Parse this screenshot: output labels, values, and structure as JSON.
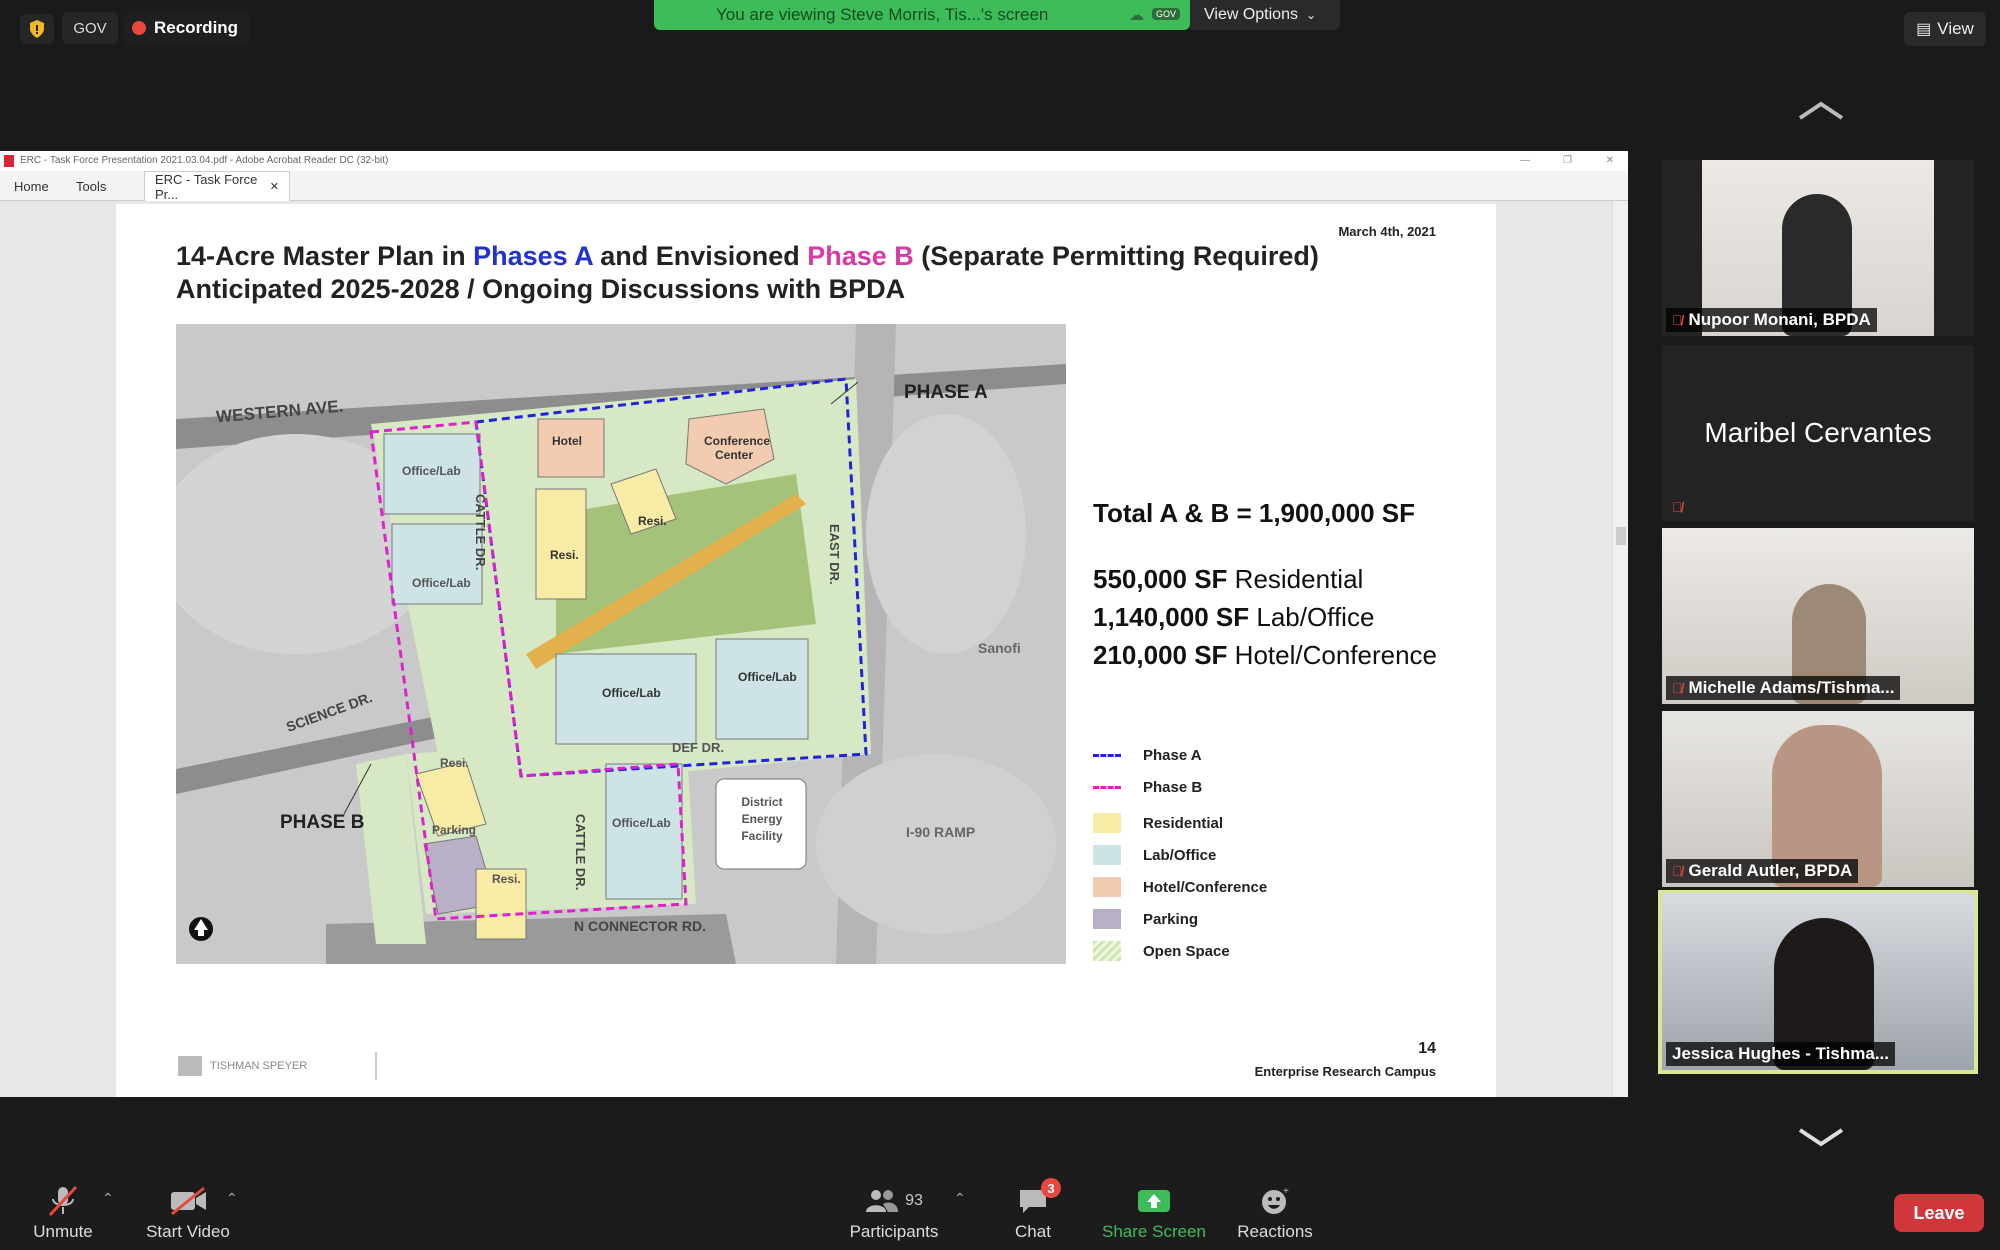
{
  "top": {
    "gov_label": "GOV",
    "recording_label": "Recording",
    "viewing_text": "You are viewing Steve Morris, Tis...'s screen",
    "viewing_badge": "GOV",
    "view_options_label": "View Options",
    "view_button_label": "View"
  },
  "acrobat": {
    "window_title": "ERC - Task Force Presentation 2021.03.04.pdf - Adobe Acrobat Reader DC (32-bit)",
    "tabs": [
      "Home",
      "Tools",
      "ERC - Task Force Pr..."
    ]
  },
  "slide": {
    "title_1": "14-Acre Master Plan in ",
    "title_phase_a": "Phases A",
    "title_2": " and Envisioned ",
    "title_phase_b": "Phase B",
    "title_3": " (Separate Permitting Required)",
    "title_line2": "Anticipated 2025-2028 / Ongoing Discussions with BPDA",
    "date": "March 4th, 2021",
    "total": "Total A & B = 1,900,000 SF",
    "areas": [
      {
        "value": "550,000 SF",
        "label": "Residential"
      },
      {
        "value": "1,140,000 SF",
        "label": "Lab/Office"
      },
      {
        "value": "210,000 SF",
        "label": "Hotel/Conference"
      }
    ],
    "legend": [
      {
        "label": "Phase A",
        "color": "#2222dd",
        "kind": "dash"
      },
      {
        "label": "Phase B",
        "color": "#dd22cc",
        "kind": "dash"
      },
      {
        "label": "Residential",
        "color": "#f7eba5",
        "kind": "fill"
      },
      {
        "label": "Lab/Office",
        "color": "#cde3e6",
        "kind": "fill"
      },
      {
        "label": "Hotel/Conference",
        "color": "#f3cbb0",
        "kind": "fill"
      },
      {
        "label": "Parking",
        "color": "#b9b0c8",
        "kind": "fill"
      },
      {
        "label": "Open Space",
        "color": "#cfe6b0",
        "kind": "hatch"
      }
    ],
    "page_number": "14",
    "campus": "Enterprise Research Campus",
    "company": "TISHMAN SPEYER",
    "map": {
      "streets": [
        "WESTERN AVE.",
        "SCIENCE DR.",
        "CATTLE DR.",
        "EAST DR.",
        "DEF DR.",
        "CATTLE DR.",
        "N CONNECTOR RD.",
        "I-90 RAMP"
      ],
      "blocks": [
        "Hotel",
        "Conference Center",
        "Office/Lab",
        "Office/Lab",
        "Resi.",
        "Resi.",
        "Office/Lab",
        "Office/Lab",
        "Resi.",
        "Parking",
        "Resi.",
        "Office/Lab",
        "District Energy Facility"
      ],
      "phase_a_label": "PHASE A",
      "phase_b_label": "PHASE B",
      "sanofi": "Sanofi"
    }
  },
  "participants": [
    {
      "name": "Nupoor Monani, BPDA",
      "muted": true
    },
    {
      "name": "Maribel Cervantes",
      "muted": true
    },
    {
      "name": "Michelle Adams/Tishma...",
      "muted": true
    },
    {
      "name": "Gerald Autler, BPDA",
      "muted": true
    },
    {
      "name": "Jessica Hughes - Tishma...",
      "muted": false
    }
  ],
  "toolbar": {
    "unmute": "Unmute",
    "start_video": "Start Video",
    "participants": "Participants",
    "participant_count": "93",
    "chat": "Chat",
    "chat_badge": "3",
    "share_screen": "Share Screen",
    "reactions": "Reactions",
    "leave": "Leave"
  }
}
